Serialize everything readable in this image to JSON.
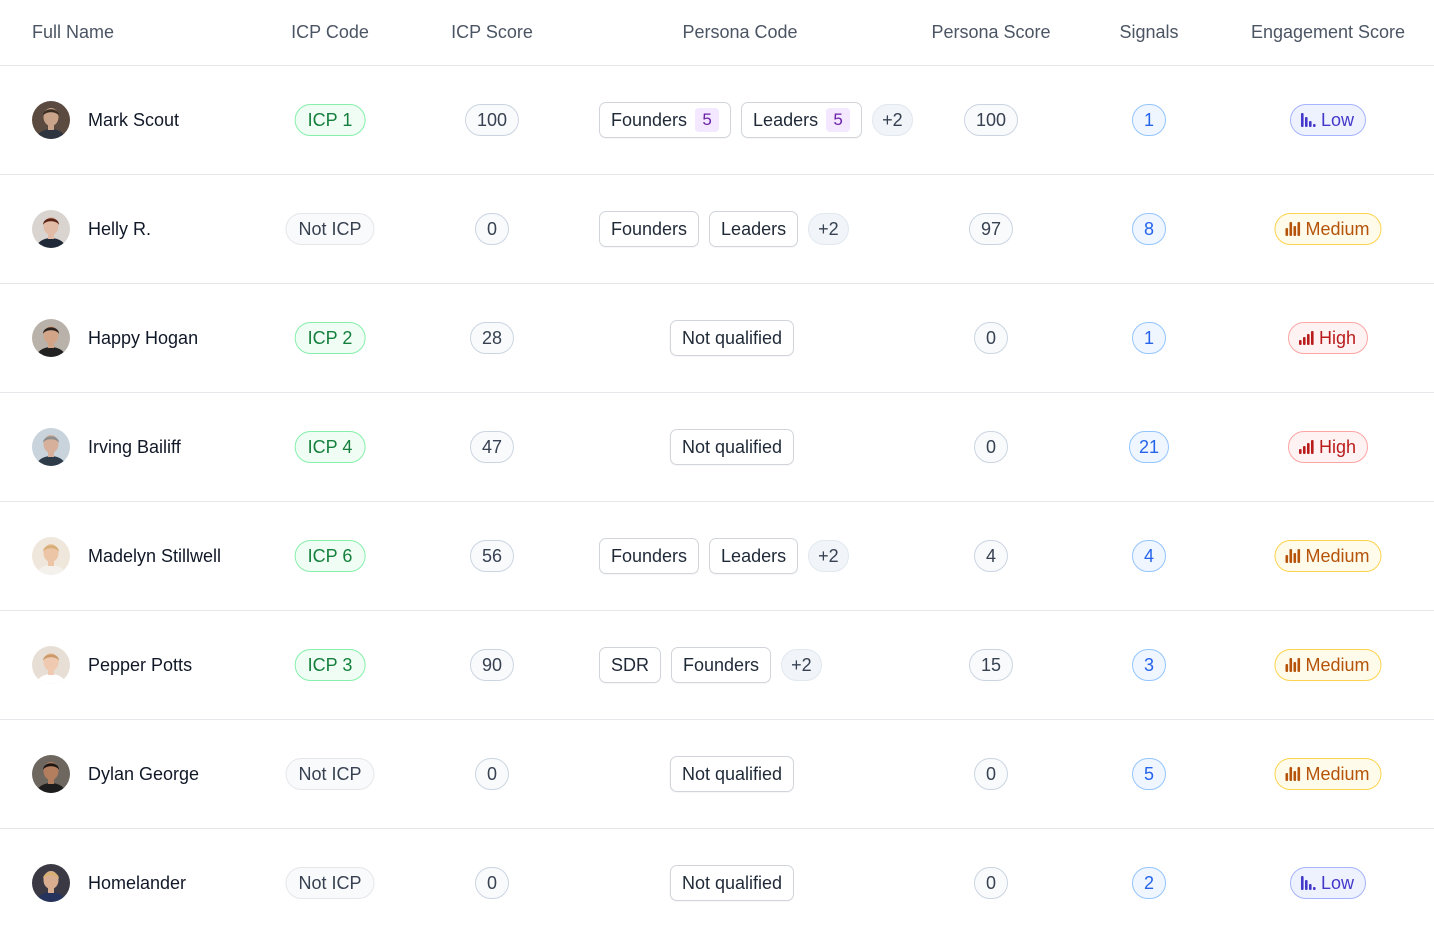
{
  "columns": {
    "full_name": "Full Name",
    "icp_code": "ICP Code",
    "icp_score": "ICP Score",
    "persona_code": "Persona Code",
    "persona_score": "Persona Score",
    "signals": "Signals",
    "engagement_score": "Engagement Score"
  },
  "rows": [
    {
      "name": "Mark Scout",
      "avatar": "avatar-photo",
      "icp_code": "ICP 1",
      "icp_type": "icp",
      "icp_score": "100",
      "persona": {
        "kind": "tags",
        "tags": [
          {
            "label": "Founders",
            "count": "5"
          },
          {
            "label": "Leaders",
            "count": "5"
          }
        ],
        "more": "+2"
      },
      "persona_score": "100",
      "signals": "1",
      "engagement": "Low",
      "engagement_level": "low"
    },
    {
      "name": "Helly R.",
      "avatar": "avatar-photo",
      "icp_code": "Not ICP",
      "icp_type": "noticp",
      "icp_score": "0",
      "persona": {
        "kind": "tags",
        "tags": [
          {
            "label": "Founders"
          },
          {
            "label": "Leaders"
          }
        ],
        "more": "+2"
      },
      "persona_score": "97",
      "signals": "8",
      "engagement": "Medium",
      "engagement_level": "medium"
    },
    {
      "name": "Happy Hogan",
      "avatar": "avatar-photo",
      "icp_code": "ICP 2",
      "icp_type": "icp",
      "icp_score": "28",
      "persona": {
        "kind": "single",
        "label": "Not qualified"
      },
      "persona_score": "0",
      "signals": "1",
      "engagement": "High",
      "engagement_level": "high"
    },
    {
      "name": "Irving Bailiff",
      "avatar": "avatar-photo",
      "icp_code": "ICP 4",
      "icp_type": "icp",
      "icp_score": "47",
      "persona": {
        "kind": "single",
        "label": "Not qualified"
      },
      "persona_score": "0",
      "signals": "21",
      "engagement": "High",
      "engagement_level": "high"
    },
    {
      "name": "Madelyn Stillwell",
      "avatar": "avatar-photo",
      "icp_code": "ICP 6",
      "icp_type": "icp",
      "icp_score": "56",
      "persona": {
        "kind": "tags",
        "tags": [
          {
            "label": "Founders"
          },
          {
            "label": "Leaders"
          }
        ],
        "more": "+2"
      },
      "persona_score": "4",
      "signals": "4",
      "engagement": "Medium",
      "engagement_level": "medium"
    },
    {
      "name": "Pepper Potts",
      "avatar": "avatar-photo",
      "icp_code": "ICP 3",
      "icp_type": "icp",
      "icp_score": "90",
      "persona": {
        "kind": "tags",
        "tags": [
          {
            "label": "SDR"
          },
          {
            "label": "Founders"
          }
        ],
        "more": "+2"
      },
      "persona_score": "15",
      "signals": "3",
      "engagement": "Medium",
      "engagement_level": "medium"
    },
    {
      "name": "Dylan George",
      "avatar": "avatar-photo",
      "icp_code": "Not ICP",
      "icp_type": "noticp",
      "icp_score": "0",
      "persona": {
        "kind": "single",
        "label": "Not qualified"
      },
      "persona_score": "0",
      "signals": "5",
      "engagement": "Medium",
      "engagement_level": "medium"
    },
    {
      "name": "Homelander",
      "avatar": "avatar-photo",
      "icp_code": "Not ICP",
      "icp_type": "noticp",
      "icp_score": "0",
      "persona": {
        "kind": "single",
        "label": "Not qualified"
      },
      "persona_score": "0",
      "signals": "2",
      "engagement": "Low",
      "engagement_level": "low"
    }
  ],
  "colors": {
    "avatars": [
      {
        "bg": "#5b4a3f",
        "skin": "#c9a48a",
        "hair": "#3a2d24",
        "shirt": "#2f3540"
      },
      {
        "bg": "#d9d4cf",
        "skin": "#e2bba6",
        "hair": "#5a2418",
        "shirt": "#1f2937"
      },
      {
        "bg": "#b9b2aa",
        "skin": "#d2a488",
        "hair": "#2b2420",
        "shirt": "#222222"
      },
      {
        "bg": "#c8d3dc",
        "skin": "#d6b09a",
        "hair": "#8e8e8e",
        "shirt": "#2e3c4a"
      },
      {
        "bg": "#efe7dc",
        "skin": "#ecc5a6",
        "hair": "#d7ae76",
        "shirt": "#f4f1ec"
      },
      {
        "bg": "#e7dfd6",
        "skin": "#efc9b0",
        "hair": "#c99a68",
        "shirt": "#ffffff"
      },
      {
        "bg": "#6d6760",
        "skin": "#b37e5e",
        "hair": "#1c1714",
        "shirt": "#1d1d1d"
      },
      {
        "bg": "#3b3a44",
        "skin": "#d9ae90",
        "hair": "#d8b070",
        "shirt": "#26335c"
      }
    ],
    "icp_green": "#15803d",
    "signal_blue": "#2563eb",
    "engagement_low": "#4338ca",
    "engagement_medium": "#b45309",
    "engagement_high": "#b91c1c"
  }
}
